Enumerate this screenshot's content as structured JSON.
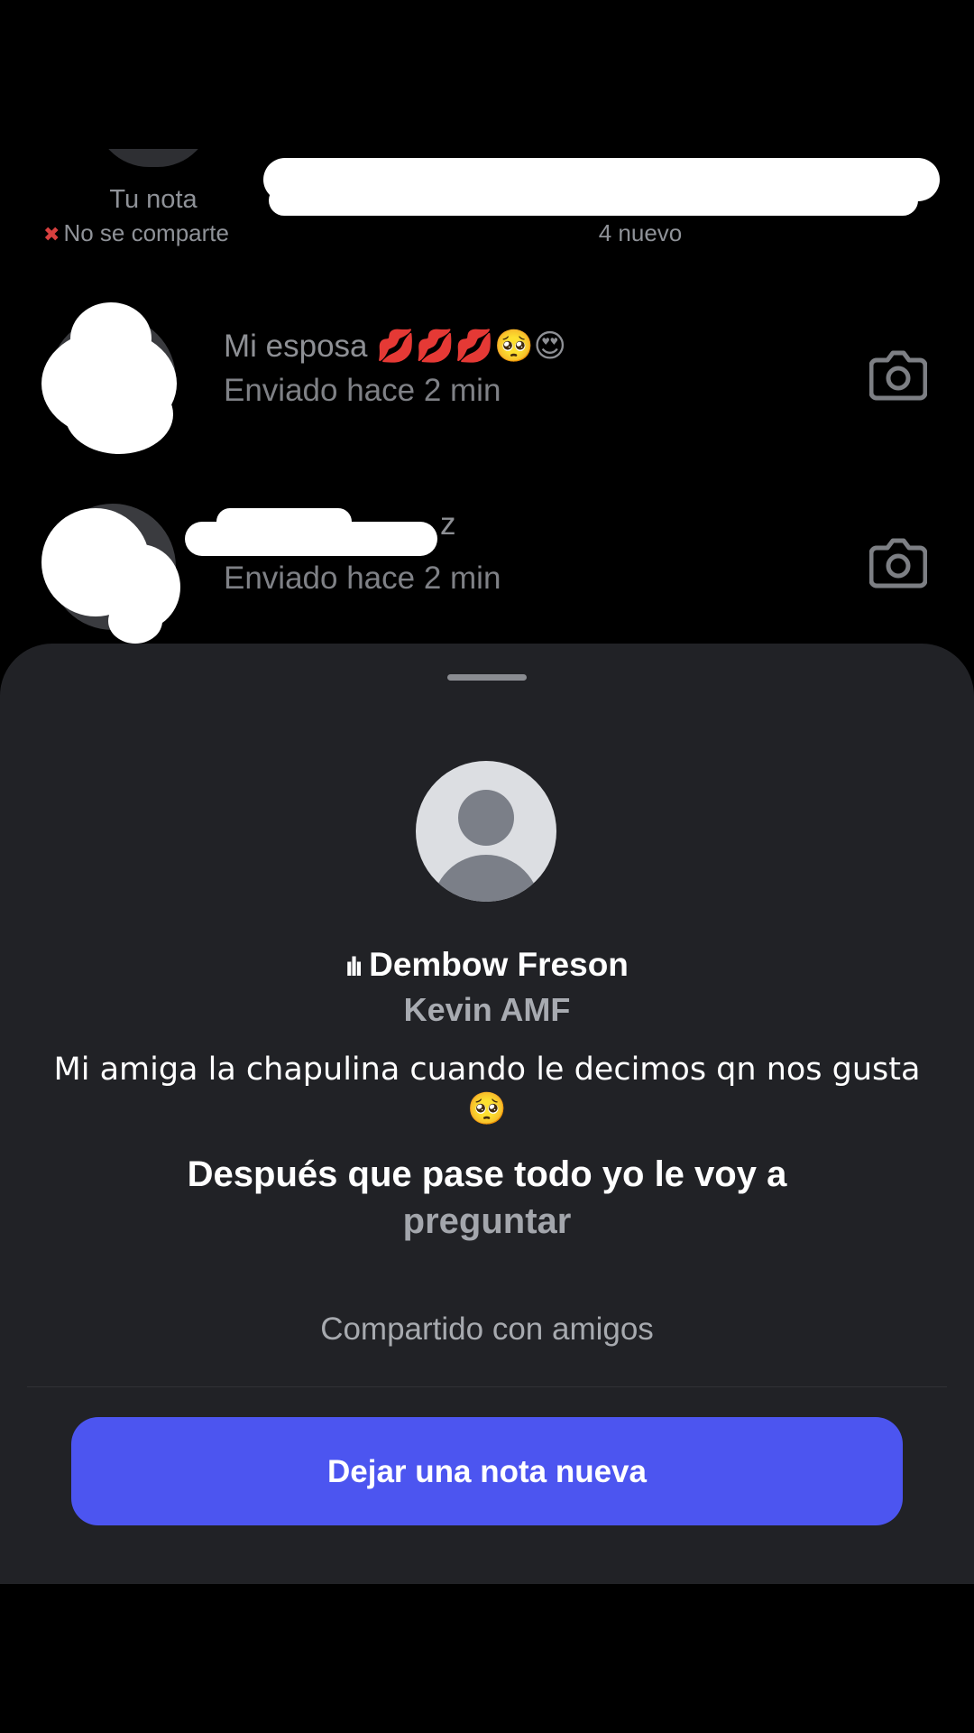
{
  "notes_row": {
    "my_note_label": "Tu nota",
    "my_note_status": "No se comparte",
    "friend_note_count": "4 nuevo"
  },
  "chats": [
    {
      "name": "Mi esposa 💋💋💋🥺😍",
      "status": "Enviado hace 2 min"
    },
    {
      "name": "z",
      "status": "Enviado hace 2 min"
    }
  ],
  "sheet": {
    "song_title": "Dembow Freson",
    "artist": "Kevin AMF",
    "note_text": "Mi amiga la chapulina cuando le decimos qn nos gusta 🥺",
    "lyric_line1": "Después que pase todo yo le voy a",
    "lyric_line2": "preguntar",
    "shared_label": "Compartido con amigos",
    "cta_label": "Dejar una nota nueva"
  },
  "colors": {
    "accent": "#4c55f0",
    "sheet_bg": "#212226",
    "screen_bg": "#000000"
  },
  "icons": [
    "mute-icon",
    "camera-icon",
    "music-bars-icon",
    "default-avatar-icon"
  ]
}
